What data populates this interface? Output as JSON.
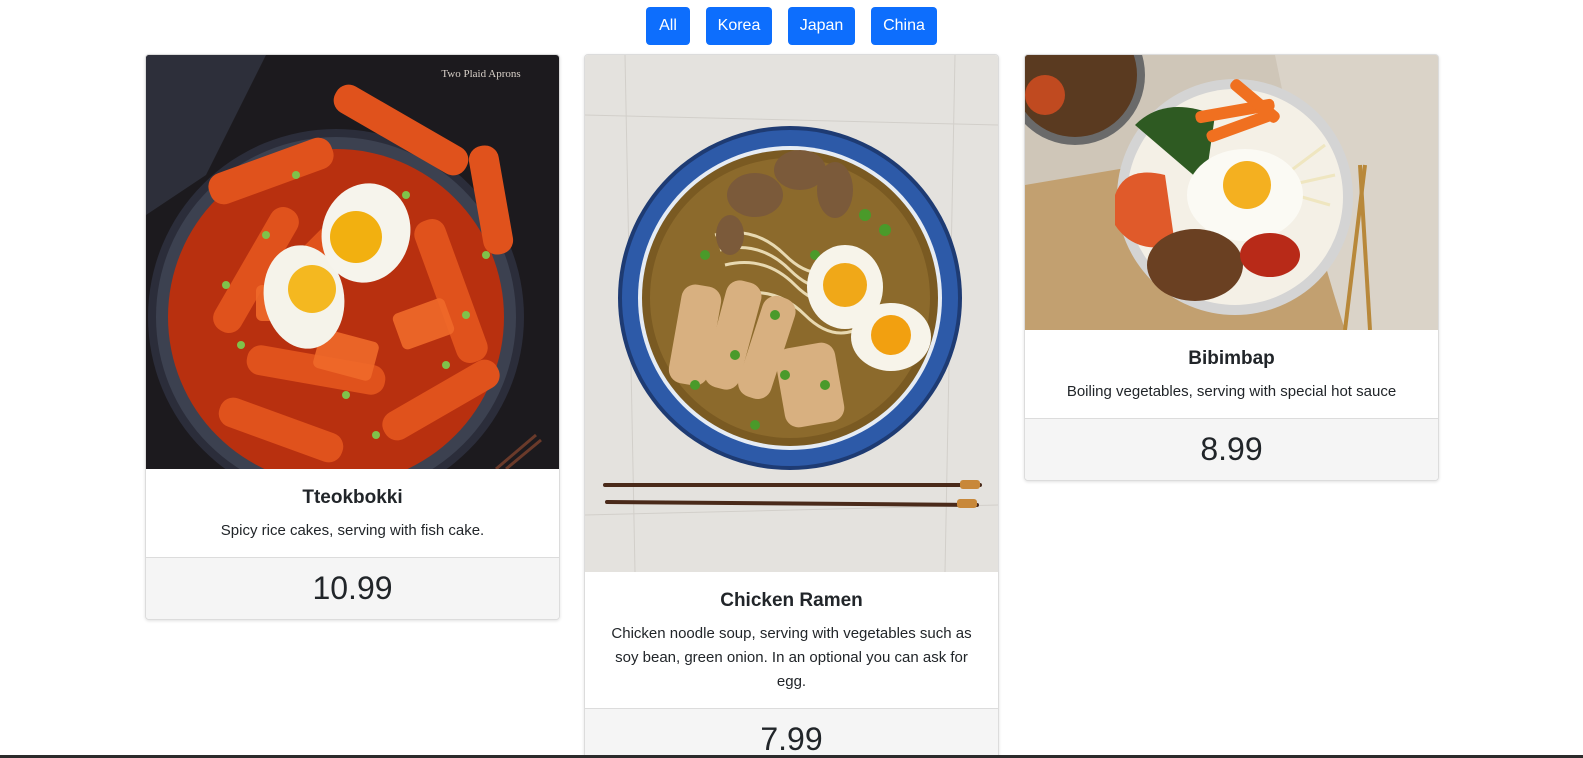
{
  "filters": [
    {
      "label": "All"
    },
    {
      "label": "Korea"
    },
    {
      "label": "Japan"
    },
    {
      "label": "China"
    }
  ],
  "colors": {
    "button": "#0d6efd",
    "footer_bg": "#f5f5f5"
  },
  "cards": [
    {
      "title": "Tteokbokki",
      "description": "Spicy rice cakes, serving with fish cake.",
      "price": "10.99",
      "image_watermark": "Two Plaid Aprons"
    },
    {
      "title": "Chicken Ramen",
      "description": "Chicken noodle soup, serving with vegetables such as soy bean, green onion. In an optional you can ask for egg.",
      "price": "7.99"
    },
    {
      "title": "Bibimbap",
      "description": "Boiling vegetables, serving with special hot sauce",
      "price": "8.99"
    }
  ]
}
